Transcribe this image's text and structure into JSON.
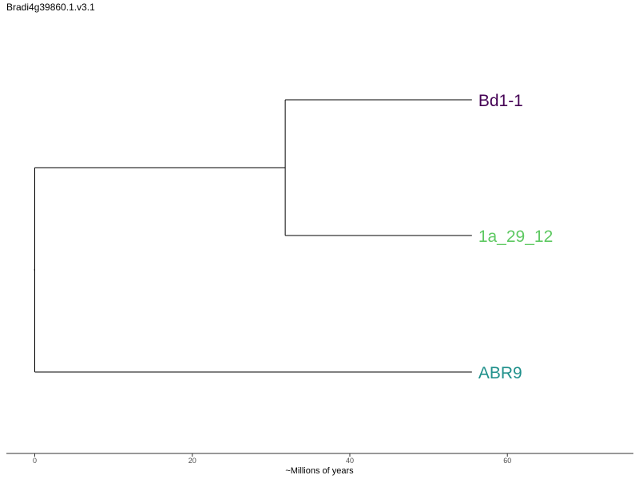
{
  "chart_data": {
    "type": "dendrogram",
    "title": "Bradi4g39860.1.v3.1",
    "xlabel": "~Millions of years",
    "xlim": [
      -3.6,
      76
    ],
    "x_ticks": [
      0,
      20,
      40,
      60
    ],
    "root_x": 0,
    "internal_nodes": [
      {
        "id": "n1",
        "x": 31.8,
        "children": [
          "Bd1-1",
          "1a_29_12"
        ]
      },
      {
        "id": "root",
        "x": 0,
        "children": [
          "n1",
          "ABR9"
        ]
      }
    ],
    "leaves": [
      {
        "name": "Bd1-1",
        "x": 55.5,
        "color": "#440154"
      },
      {
        "name": "1a_29_12",
        "x": 55.5,
        "color": "#5ec962"
      },
      {
        "name": "ABR9",
        "x": 55.5,
        "color": "#21918c"
      }
    ]
  }
}
